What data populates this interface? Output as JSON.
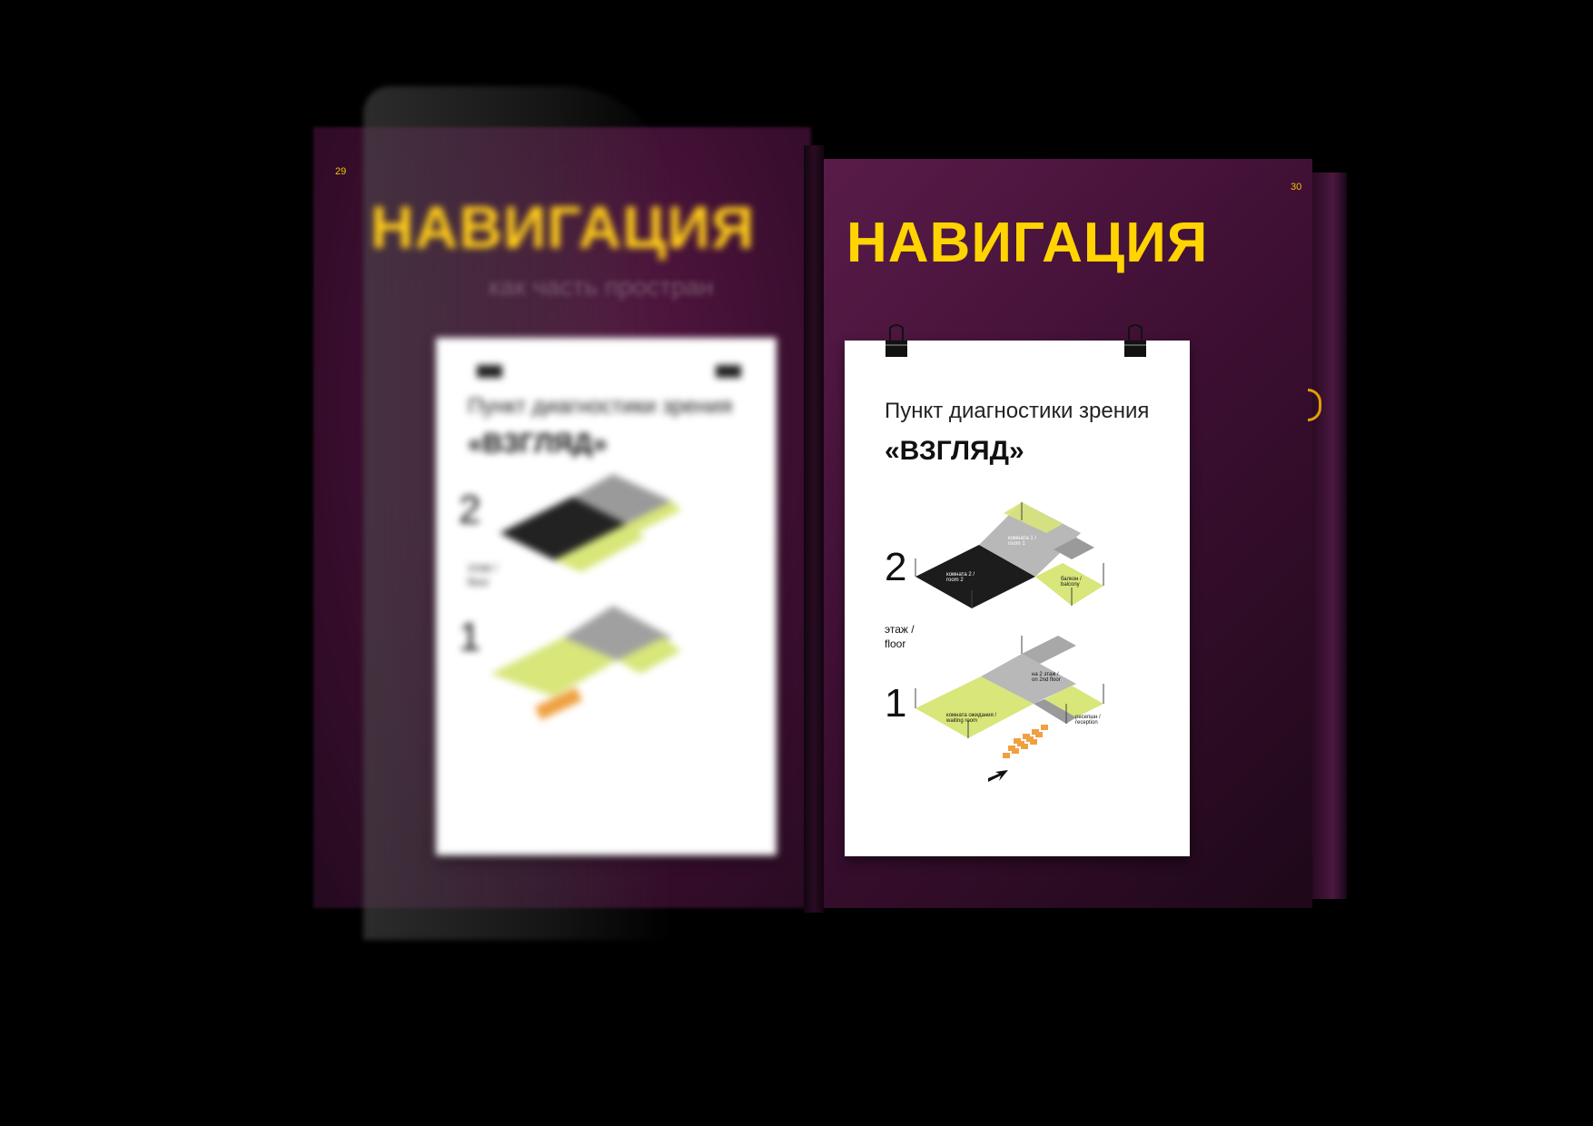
{
  "book": {
    "left_page": {
      "page_number": "29",
      "title": "НАВИГАЦИЯ",
      "subtitle": "как часть простран",
      "poster": {
        "heading": "Пункт диагностики зрения",
        "name": "«ВЗГЛЯД»",
        "floor_upper": "2",
        "floor_lower": "1",
        "floor_label_1": "этаж /",
        "floor_label_2": "floor"
      }
    },
    "right_page": {
      "page_number": "30",
      "title": "НАВИГАЦИЯ",
      "poster": {
        "heading": "Пункт диагностики зрения",
        "name": "«ВЗГЛЯД»",
        "floor_label_1": "этаж /",
        "floor_label_2": "floor",
        "floor_2": {
          "number": "2",
          "room_1": "комната 1 /",
          "room_1_en": "room 1",
          "room_2": "комната 2 /",
          "room_2_en": "room 2",
          "balcony": "балкон /",
          "balcony_en": "balcony"
        },
        "floor_1": {
          "number": "1",
          "waiting": "комната ожидания /",
          "waiting_en": "waiting room",
          "stairs": "на 2 этаж /",
          "stairs_en": "on 2nd floor",
          "reception": "ресепшн /",
          "reception_en": "reception"
        }
      }
    }
  },
  "colors": {
    "background": "#000000",
    "page": "#4a1440",
    "title_yellow": "#ffd400",
    "floor_yellow": "#d8e67a",
    "floor_gray": "#b5b5b5",
    "floor_dark": "#1c1c1c",
    "tactile_orange": "#f0a040"
  },
  "icons": [
    "binder-clip-icon",
    "arrow-icon"
  ]
}
